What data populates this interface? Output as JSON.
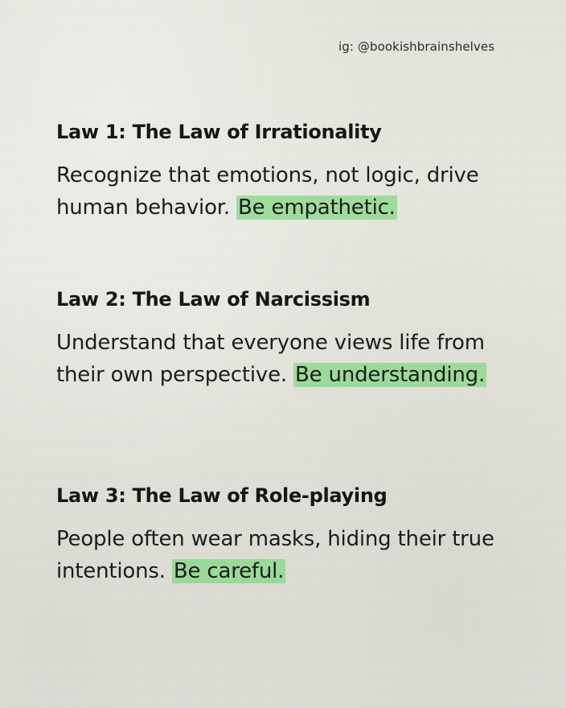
{
  "handle": "ig: @bookishbrainshelves",
  "laws": [
    {
      "title": "Law 1: The Law of Irrationality",
      "text": "Recognize that emotions, not logic, drive human behavior.",
      "highlight": "Be empathetic."
    },
    {
      "title": "Law 2: The Law of Narcissism",
      "text": "Understand that everyone views life from their own perspective.",
      "highlight": "Be understanding."
    },
    {
      "title": "Law 3: The Law of Role-playing",
      "text": "People often wear masks, hiding their true intentions.",
      "highlight": "Be careful."
    }
  ],
  "colors": {
    "highlight": "#7ed67e",
    "paper": "#e5e5de",
    "text": "#1c1c1c"
  }
}
